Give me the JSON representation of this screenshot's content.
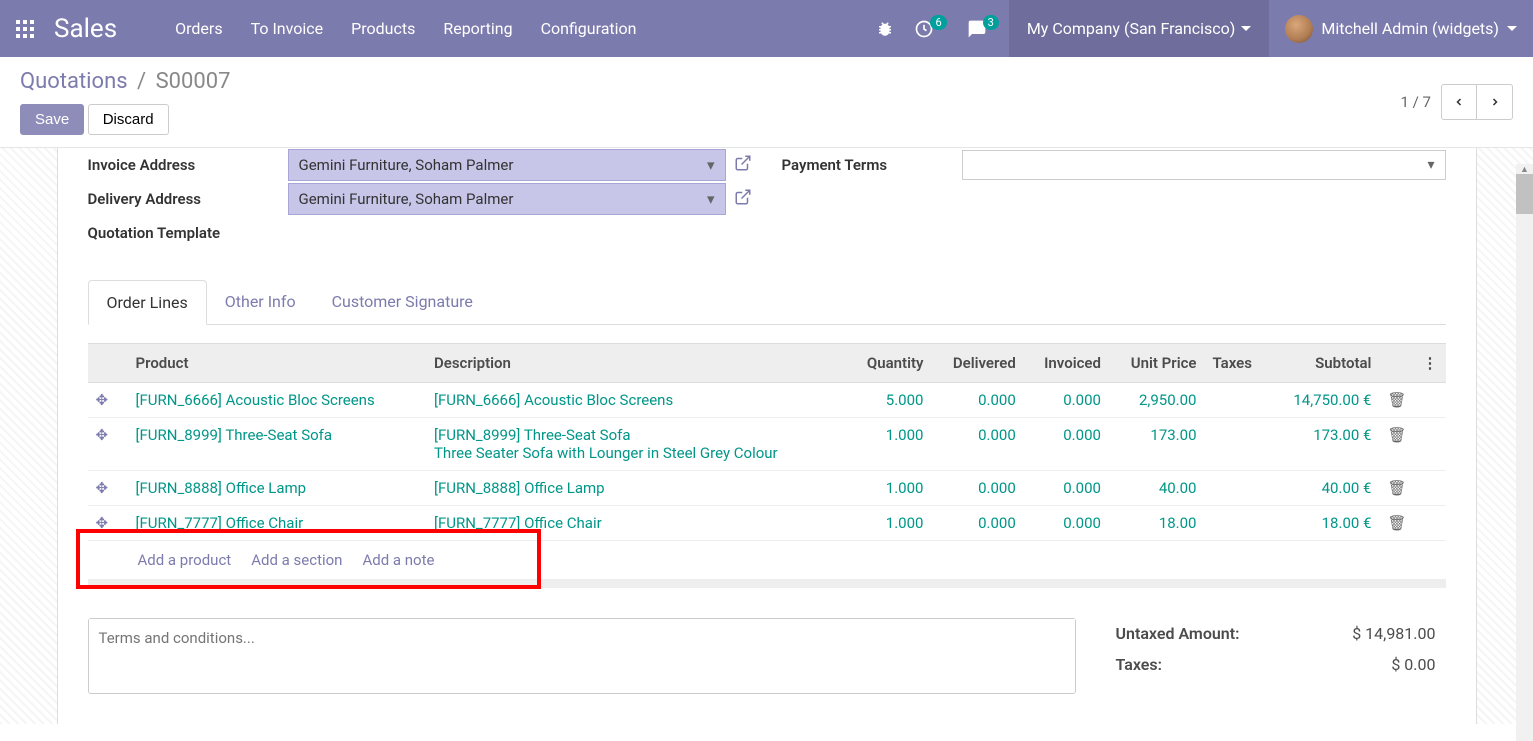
{
  "brand": "Sales",
  "nav": {
    "orders": "Orders",
    "to_invoice": "To Invoice",
    "products": "Products",
    "reporting": "Reporting",
    "configuration": "Configuration"
  },
  "badges": {
    "timer": "6",
    "chat": "3"
  },
  "company": "My Company (San Francisco)",
  "user": "Mitchell Admin (widgets)",
  "breadcrumb": {
    "root": "Quotations",
    "sep": "/",
    "current": "S00007"
  },
  "buttons": {
    "save": "Save",
    "discard": "Discard"
  },
  "pager": "1 / 7",
  "form": {
    "invoice_addr_label": "Invoice Address",
    "delivery_addr_label": "Delivery Address",
    "quotation_tpl_label": "Quotation Template",
    "payment_terms_label": "Payment Terms",
    "invoice_addr_value": "Gemini Furniture, Soham Palmer",
    "delivery_addr_value": "Gemini Furniture, Soham Palmer"
  },
  "tabs": {
    "order_lines": "Order Lines",
    "other_info": "Other Info",
    "customer_signature": "Customer Signature"
  },
  "table": {
    "headers": {
      "product": "Product",
      "description": "Description",
      "quantity": "Quantity",
      "delivered": "Delivered",
      "invoiced": "Invoiced",
      "unit_price": "Unit Price",
      "taxes": "Taxes",
      "subtotal": "Subtotal"
    },
    "rows": [
      {
        "product": "[FURN_6666] Acoustic Bloc Screens",
        "desc": "[FURN_6666] Acoustic Bloc Screens",
        "qty": "5.000",
        "del": "0.000",
        "inv": "0.000",
        "price": "2,950.00",
        "sub": "14,750.00 €"
      },
      {
        "product": "[FURN_8999] Three-Seat Sofa",
        "desc": "[FURN_8999] Three-Seat Sofa\nThree Seater Sofa with Lounger in Steel Grey Colour",
        "qty": "1.000",
        "del": "0.000",
        "inv": "0.000",
        "price": "173.00",
        "sub": "173.00 €"
      },
      {
        "product": "[FURN_8888] Office Lamp",
        "desc": "[FURN_8888] Office Lamp",
        "qty": "1.000",
        "del": "0.000",
        "inv": "0.000",
        "price": "40.00",
        "sub": "40.00 €"
      },
      {
        "product": "[FURN_7777] Office Chair",
        "desc": "[FURN_7777] Office Chair",
        "qty": "1.000",
        "del": "0.000",
        "inv": "0.000",
        "price": "18.00",
        "sub": "18.00 €"
      }
    ],
    "add_product": "Add a product",
    "add_section": "Add a section",
    "add_note": "Add a note"
  },
  "terms_placeholder": "Terms and conditions...",
  "totals": {
    "untaxed_label": "Untaxed Amount:",
    "untaxed_value": "$ 14,981.00",
    "taxes_label": "Taxes:",
    "taxes_value": "$ 0.00"
  }
}
